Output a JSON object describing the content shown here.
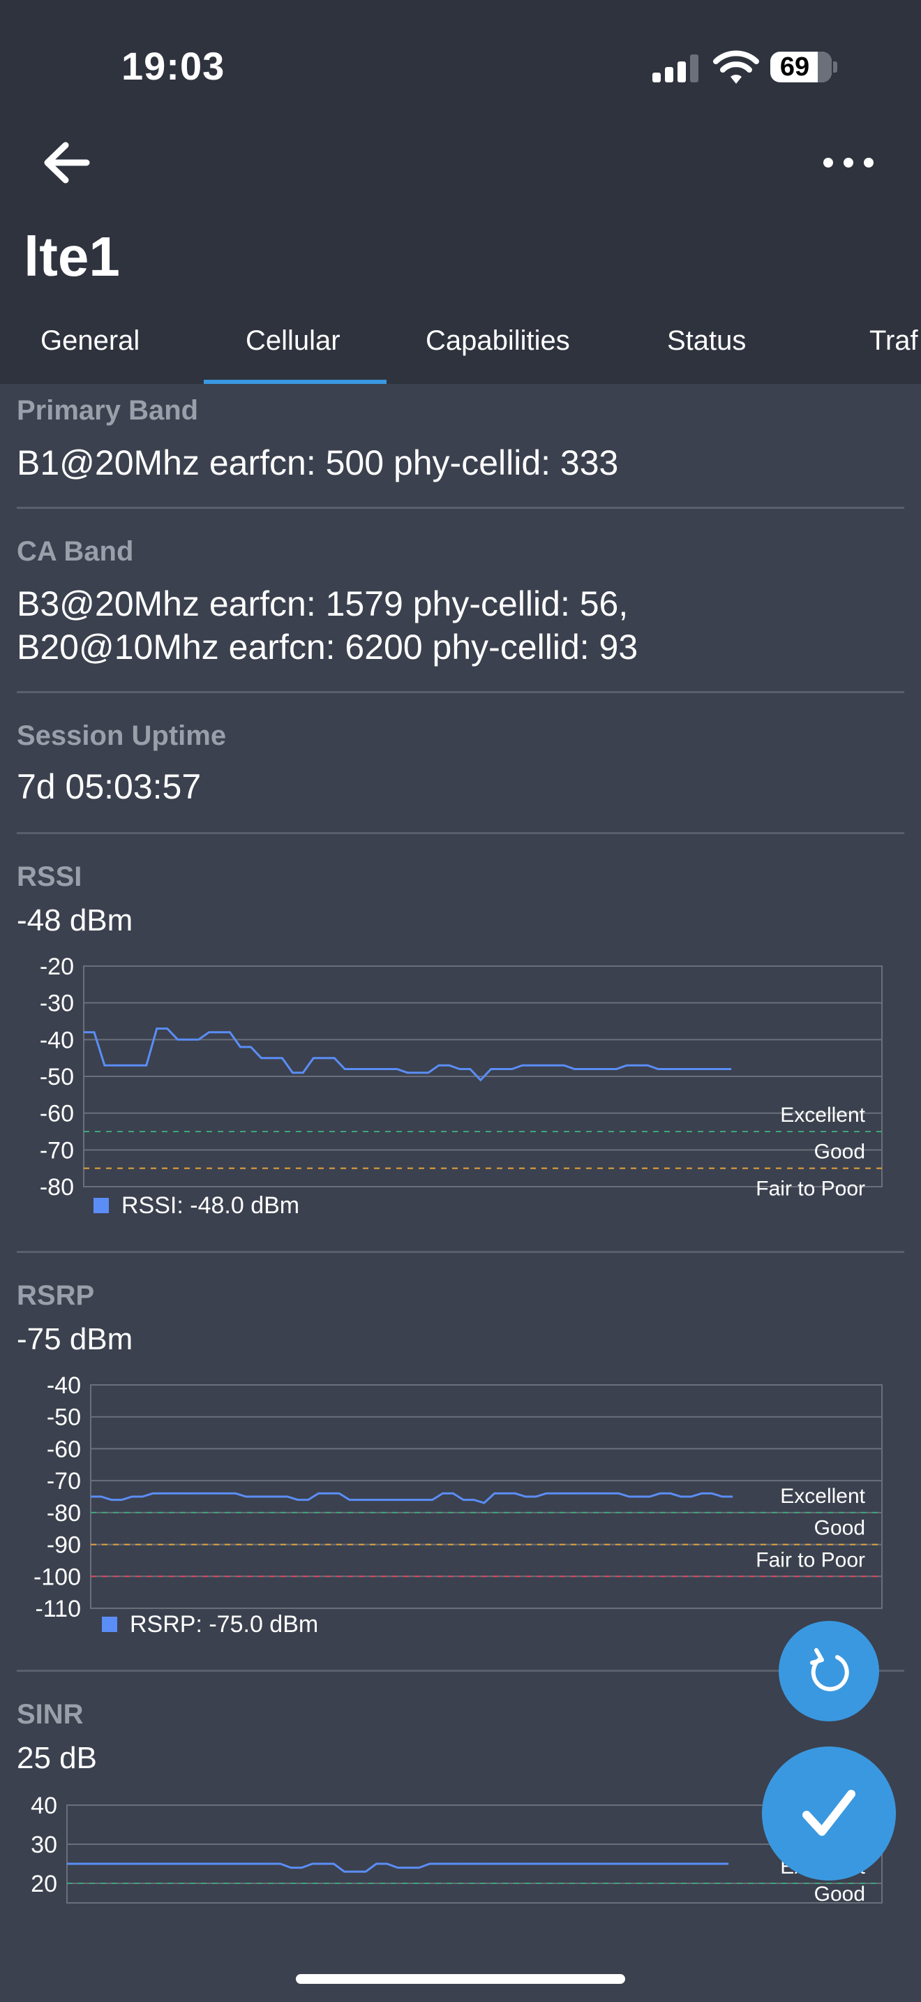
{
  "status_bar": {
    "time": "19:03",
    "battery": "69"
  },
  "header": {
    "title": "lte1"
  },
  "tabs": [
    {
      "label": "General"
    },
    {
      "label": "Cellular",
      "active": true
    },
    {
      "label": "Capabilities"
    },
    {
      "label": "Status"
    },
    {
      "label": "Traf"
    }
  ],
  "fields": {
    "primary_band": {
      "label": "Primary Band",
      "value": "B1@20Mhz earfcn: 500 phy-cellid: 333"
    },
    "ca_band": {
      "label": "CA Band",
      "value_line1": "B3@20Mhz earfcn: 1579 phy-cellid: 56,",
      "value_line2": "B20@10Mhz earfcn: 6200 phy-cellid: 93"
    },
    "session_uptime": {
      "label": "Session Uptime",
      "value": "7d 05:03:57"
    }
  },
  "metrics": {
    "rssi": {
      "label": "RSSI",
      "value": "-48  dBm",
      "legend": "RSSI: -48.0  dBm"
    },
    "rsrp": {
      "label": "RSRP",
      "value": "-75  dBm",
      "legend": "RSRP: -75.0  dBm"
    },
    "sinr": {
      "label": "SINR",
      "value": "25  dB"
    }
  },
  "colors": {
    "line": "#5b8df6",
    "excellent": "#3fa57a",
    "good": "#e5a33b",
    "poor": "#e0455f",
    "accent": "#3a98e0"
  },
  "icons": {
    "back": "arrow-left-icon",
    "more": "more-horizontal-icon",
    "refresh": "refresh-icon",
    "confirm": "checkmark-icon"
  },
  "chart_data": [
    {
      "type": "line",
      "ylim": [
        -80,
        -20
      ],
      "yticks": [
        "-20",
        "-30",
        "-40",
        "-50",
        "-60",
        "-70",
        "-80"
      ],
      "thresholds": [
        {
          "label": "Excellent",
          "value": -65,
          "color": "#3fa57a"
        },
        {
          "label": "Good",
          "value": -75,
          "color": "#e5a33b"
        },
        {
          "label": "Fair to Poor",
          "value": -85,
          "color": "#e0455f"
        }
      ],
      "series": [
        {
          "name": "RSSI: -48.0  dBm",
          "values": [
            -38,
            -38,
            -47,
            -47,
            -47,
            -47,
            -47,
            -37,
            -37,
            -40,
            -40,
            -40,
            -38,
            -38,
            -38,
            -42,
            -42,
            -45,
            -45,
            -45,
            -49,
            -49,
            -45,
            -45,
            -45,
            -48,
            -48,
            -48,
            -48,
            -48,
            -48,
            -49,
            -49,
            -49,
            -47,
            -47,
            -48,
            -48,
            -51,
            -48,
            -48,
            -48,
            -47,
            -47,
            -47,
            -47,
            -47,
            -48,
            -48,
            -48,
            -48,
            -48,
            -47,
            -47,
            -47,
            -48,
            -48,
            -48,
            -48,
            -48,
            -48,
            -48,
            -48
          ]
        }
      ]
    },
    {
      "type": "line",
      "ylim": [
        -110,
        -40
      ],
      "yticks": [
        "-40",
        "-50",
        "-60",
        "-70",
        "-80",
        "-90",
        "-100",
        "-110"
      ],
      "thresholds": [
        {
          "label": "Excellent",
          "value": -80,
          "color": "#3fa57a"
        },
        {
          "label": "Good",
          "value": -90,
          "color": "#e5a33b"
        },
        {
          "label": "Fair to Poor",
          "value": -100,
          "color": "#e0455f"
        }
      ],
      "series": [
        {
          "name": "RSRP: -75.0  dBm",
          "values": [
            -75,
            -75,
            -76,
            -76,
            -75,
            -75,
            -74,
            -74,
            -74,
            -74,
            -74,
            -74,
            -74,
            -74,
            -74,
            -75,
            -75,
            -75,
            -75,
            -75,
            -76,
            -76,
            -74,
            -74,
            -74,
            -76,
            -76,
            -76,
            -76,
            -76,
            -76,
            -76,
            -76,
            -76,
            -74,
            -74,
            -76,
            -76,
            -77,
            -74,
            -74,
            -74,
            -75,
            -75,
            -74,
            -74,
            -74,
            -74,
            -74,
            -74,
            -74,
            -74,
            -75,
            -75,
            -75,
            -74,
            -74,
            -75,
            -75,
            -74,
            -74,
            -75,
            -75
          ]
        }
      ]
    },
    {
      "type": "line",
      "ylim": [
        15,
        40
      ],
      "yticks": [
        "40",
        "30",
        "20"
      ],
      "thresholds": [
        {
          "label": "Excellent",
          "value": 20,
          "color": "#3fa57a"
        },
        {
          "label": "Good",
          "value": 13,
          "color": "#e5a33b"
        }
      ],
      "series": [
        {
          "name": "SINR",
          "values": [
            25,
            25,
            25,
            25,
            25,
            25,
            25,
            25,
            25,
            25,
            25,
            25,
            25,
            25,
            25,
            25,
            25,
            25,
            25,
            25,
            25,
            24,
            24,
            25,
            25,
            25,
            23,
            23,
            23,
            25,
            25,
            24,
            24,
            24,
            25,
            25,
            25,
            25,
            25,
            25,
            25,
            25,
            25,
            25,
            25,
            25,
            25,
            25,
            25,
            25,
            25,
            25,
            25,
            25,
            25,
            25,
            25,
            25,
            25,
            25,
            25,
            25,
            25
          ]
        }
      ]
    }
  ]
}
